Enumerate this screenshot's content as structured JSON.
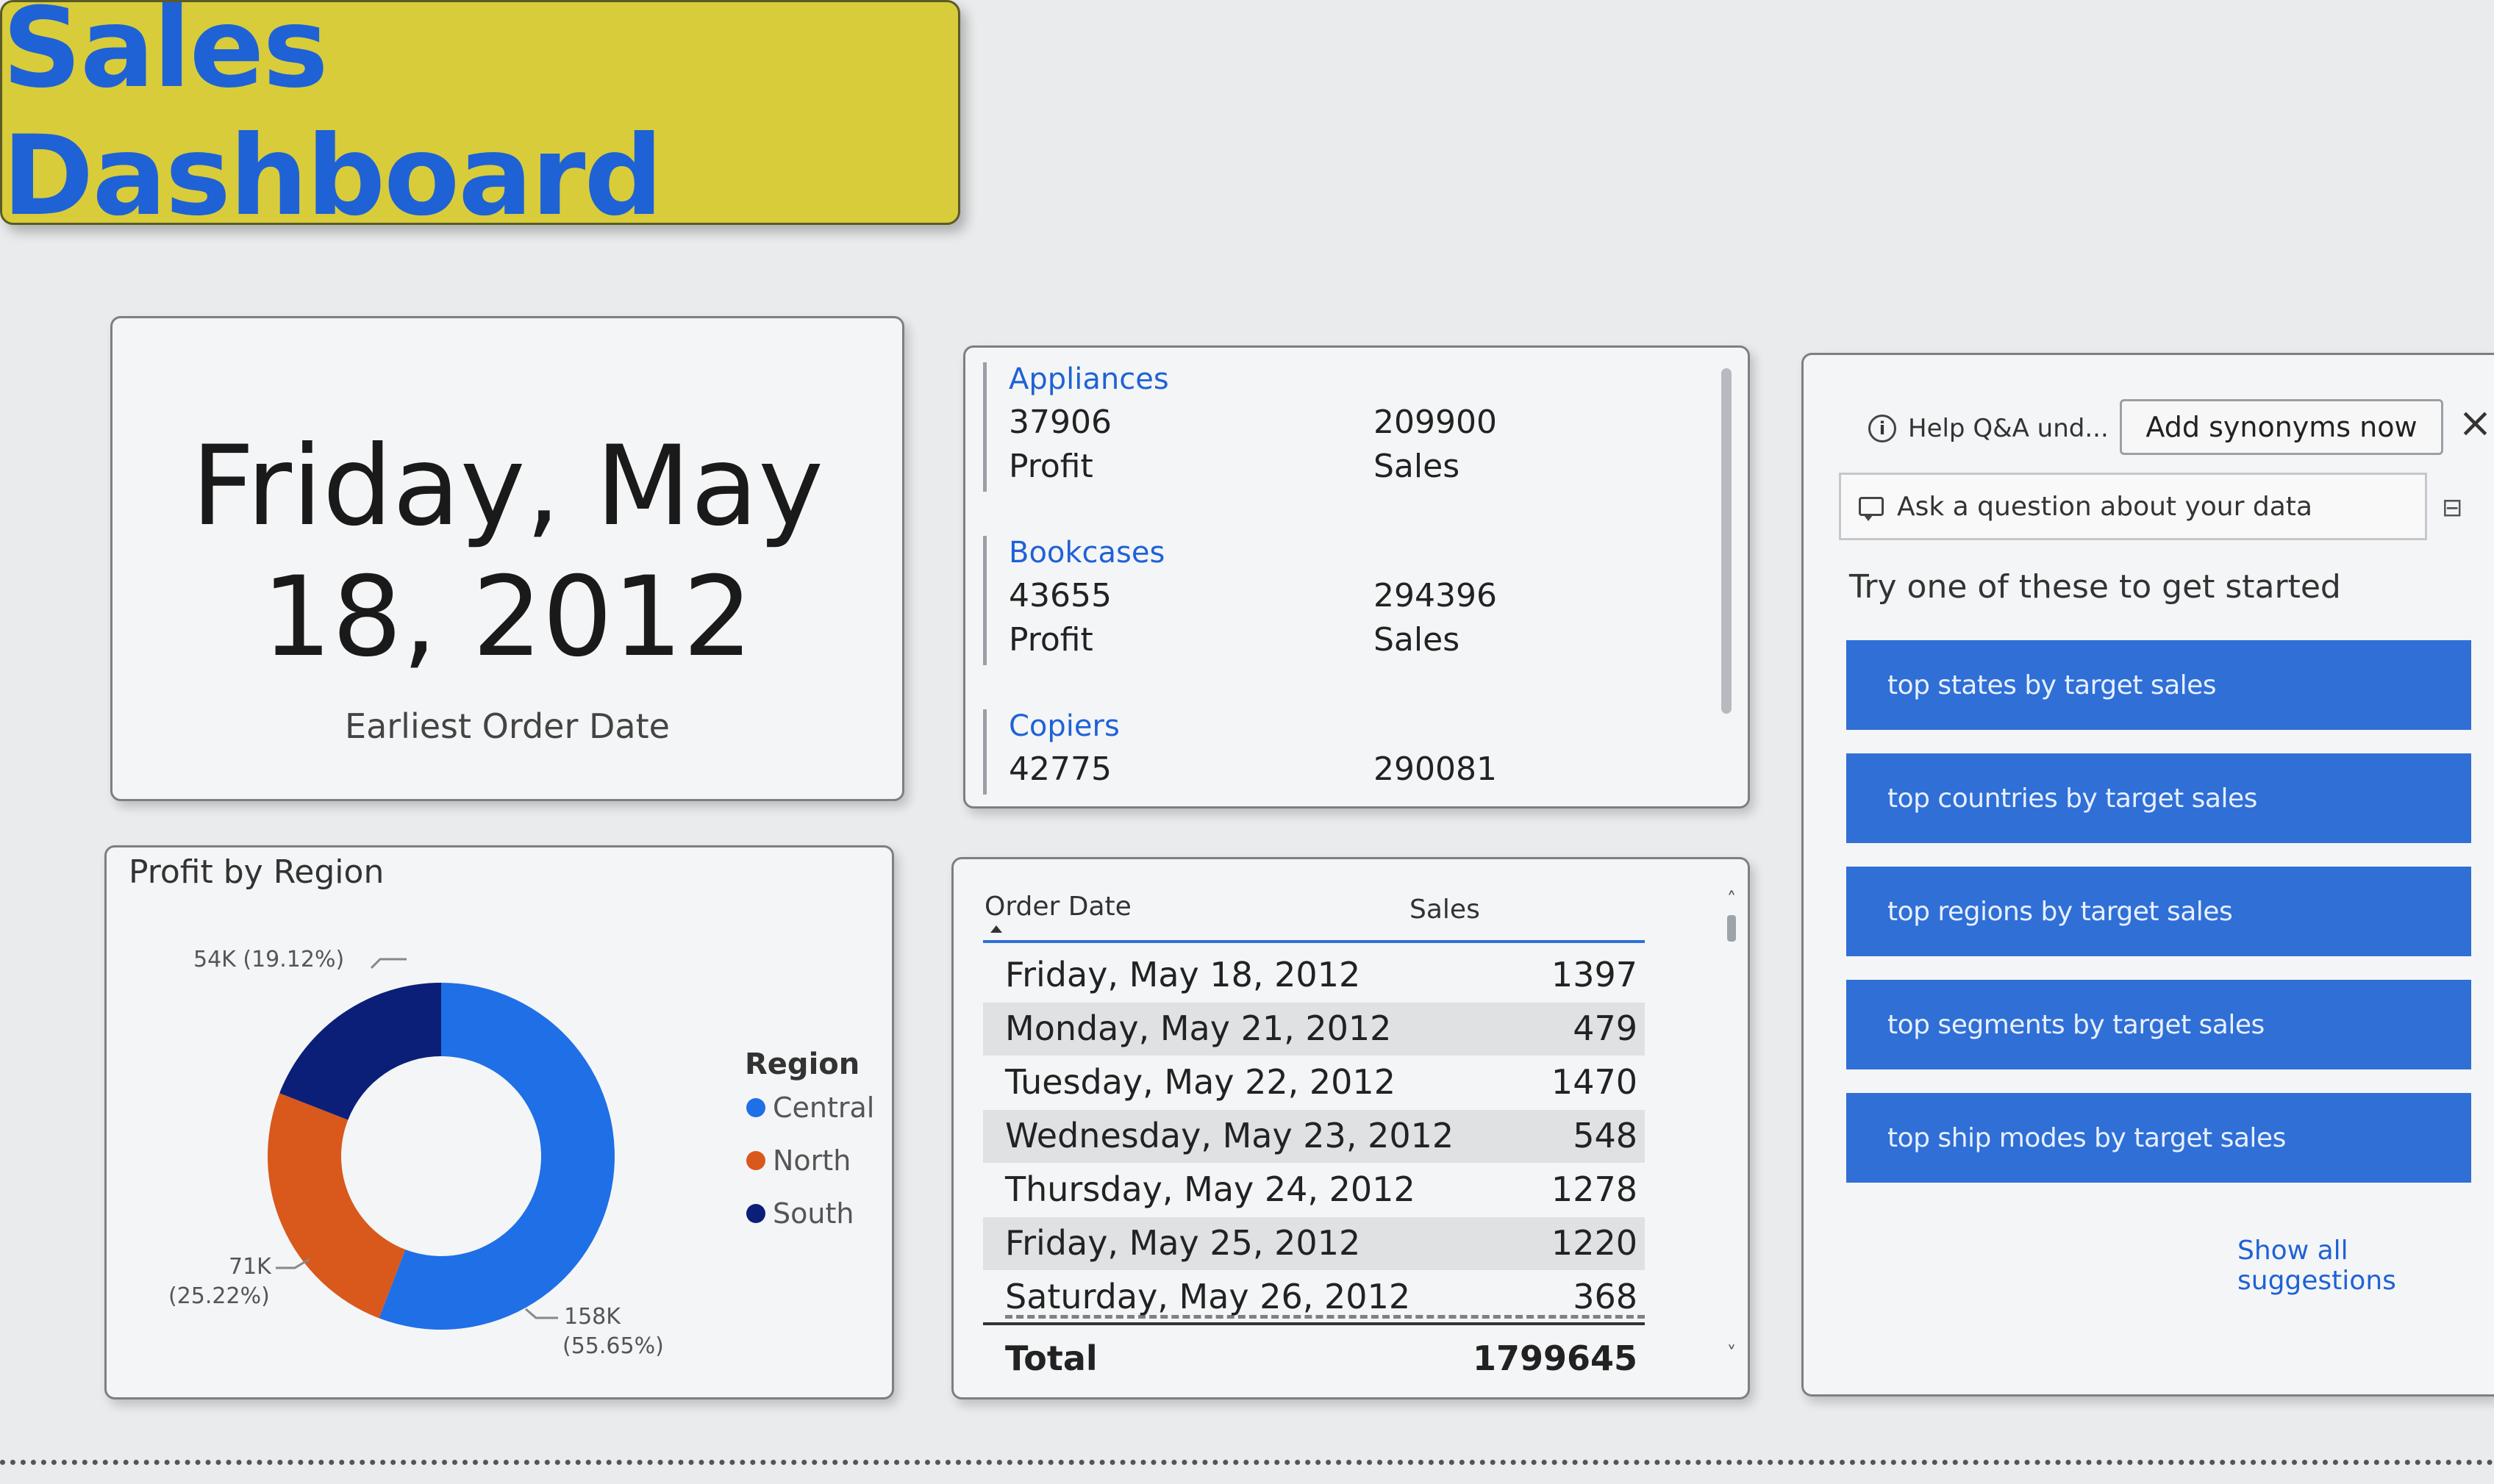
{
  "title": "Sales Dashboard",
  "date_card": {
    "value_line1": "Friday, May",
    "value_line2": "18, 2012",
    "label": "Earliest Order Date"
  },
  "categories": [
    {
      "name": "Appliances",
      "profit": "37906",
      "profit_label": "Profit",
      "sales": "209900",
      "sales_label": "Sales"
    },
    {
      "name": "Bookcases",
      "profit": "43655",
      "profit_label": "Profit",
      "sales": "294396",
      "sales_label": "Sales"
    },
    {
      "name": "Copiers",
      "profit": "42775",
      "profit_label": "",
      "sales": "290081",
      "sales_label": ""
    }
  ],
  "profit_by_region": {
    "title": "Profit by Region",
    "legend_title": "Region",
    "legend": [
      "Central",
      "North",
      "South"
    ],
    "labels": {
      "central_value": "158K",
      "central_pct": "(55.65%)",
      "north_value": "71K",
      "north_pct": "(25.22%)",
      "south": "54K (19.12%)"
    },
    "colors": {
      "central": "#1f6fe6",
      "north": "#d9581c",
      "south": "#0b1f78"
    }
  },
  "chart_data": {
    "type": "pie",
    "title": "Profit by Region",
    "categories": [
      "Central",
      "North",
      "South"
    ],
    "values": [
      158000,
      71000,
      54000
    ],
    "percentages": [
      55.65,
      25.22,
      19.12
    ],
    "legend": "right"
  },
  "sales_table": {
    "headers": [
      "Order Date",
      "Sales"
    ],
    "rows": [
      {
        "date": "Friday, May 18, 2012",
        "sales": "1397"
      },
      {
        "date": "Monday, May 21, 2012",
        "sales": "479"
      },
      {
        "date": "Tuesday, May 22, 2012",
        "sales": "1470"
      },
      {
        "date": "Wednesday, May 23, 2012",
        "sales": "548"
      },
      {
        "date": "Thursday, May 24, 2012",
        "sales": "1278"
      },
      {
        "date": "Friday, May 25, 2012",
        "sales": "1220"
      },
      {
        "date": "Saturday, May 26, 2012",
        "sales": "368"
      }
    ],
    "total_label": "Total",
    "total_value": "1799645"
  },
  "qa": {
    "info_text": "Help Q&A und...",
    "add_synonyms": "Add synonyms now",
    "input_placeholder": "Ask a question about your data",
    "prompt": "Try one of these to get started",
    "suggestions": [
      "top states by target sales",
      "top countries by target sales",
      "top regions by target sales",
      "top segments by target sales",
      "top ship modes by target sales"
    ],
    "show_all": "Show all suggestions"
  }
}
